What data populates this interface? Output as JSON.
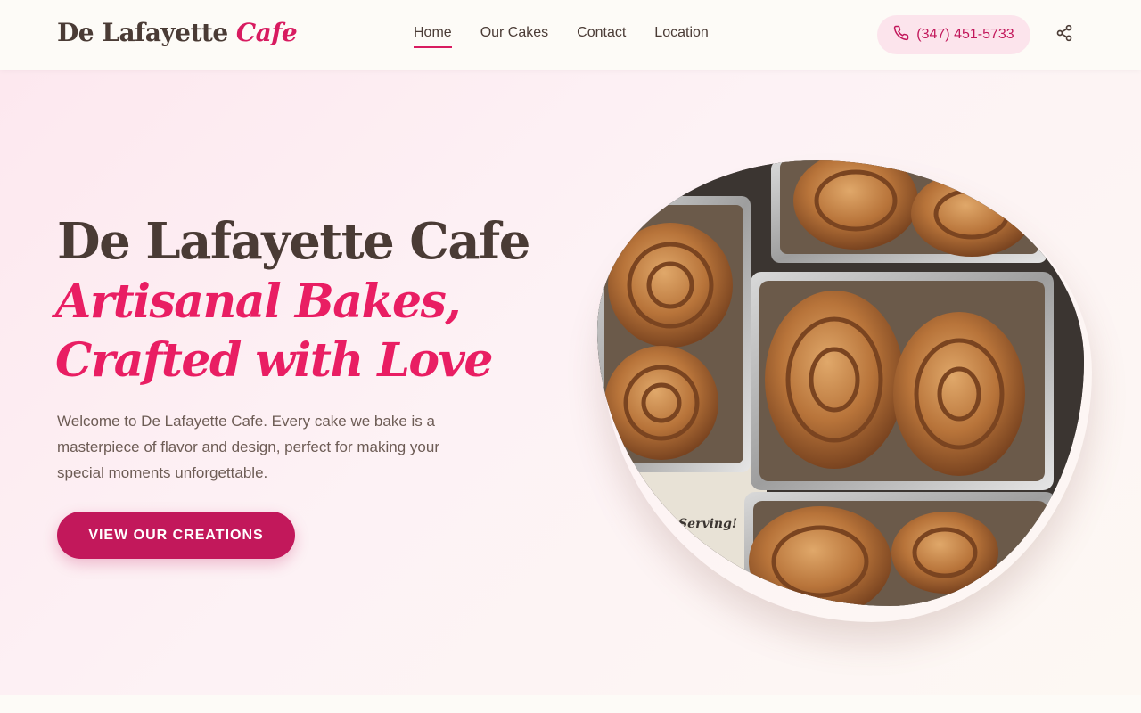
{
  "brand": {
    "name": "De Lafayette",
    "accent": "Cafe",
    "accent_color": "#d81b60"
  },
  "nav": {
    "items": [
      {
        "label": "Home",
        "active": true
      },
      {
        "label": "Our Cakes",
        "active": false
      },
      {
        "label": "Contact",
        "active": false
      },
      {
        "label": "Location",
        "active": false
      }
    ]
  },
  "header": {
    "phone": "(347) 451-5733",
    "phone_icon": "phone-icon",
    "share_icon": "share-icon"
  },
  "hero": {
    "title": "De Lafayette Cafe",
    "subtitle_line1": "Artisanal Bakes,",
    "subtitle_line2": "Crafted with Love",
    "description": "Welcome to De Lafayette Cafe. Every cake we bake is a masterpiece of flavor and design, perfect for making your special moments unforgettable.",
    "cta_label": "VIEW OUR CREATIONS",
    "image_alt": "cinnamon-rolls-photo"
  },
  "colors": {
    "primary": "#c2185b",
    "accent_text": "#e91e63",
    "text_dark": "#4a3b35",
    "text_muted": "#6d5c55",
    "phone_bg": "#fce4ec"
  }
}
